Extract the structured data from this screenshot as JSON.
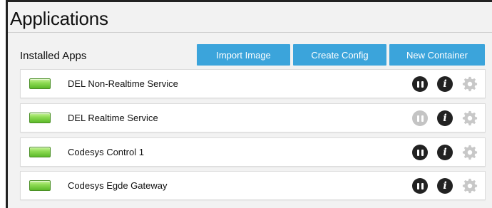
{
  "page": {
    "title": "Applications"
  },
  "installed": {
    "heading": "Installed Apps",
    "buttons": {
      "import_label": "Import Image",
      "config_label": "Create Config",
      "new_label": "New Container"
    },
    "apps": [
      {
        "name": "DEL Non-Realtime Service",
        "status": "running",
        "pause_enabled": true
      },
      {
        "name": "DEL Realtime Service",
        "status": "running",
        "pause_enabled": false
      },
      {
        "name": "Codesys Control 1",
        "status": "running",
        "pause_enabled": true
      },
      {
        "name": "Codesys Egde Gateway",
        "status": "running",
        "pause_enabled": true
      }
    ],
    "icons": {
      "status": "status-led-icon",
      "pause": "pause-icon",
      "info": "info-icon",
      "settings": "gear-icon"
    }
  },
  "colors": {
    "accent": "#3ba4db",
    "led_green": "#7ccf45",
    "control_dark": "#222222",
    "control_disabled": "#c4c4c4",
    "gear_grey": "#c8c8c8"
  }
}
